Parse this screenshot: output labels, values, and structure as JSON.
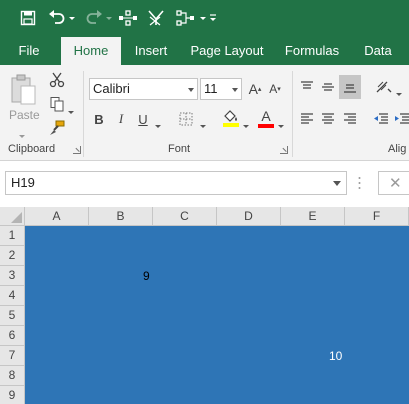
{
  "qat": {
    "icons": [
      "save-icon",
      "undo-icon",
      "redo-icon",
      "group-icon",
      "filter-icon",
      "ungroup-icon",
      "customize-icon"
    ]
  },
  "tabs": [
    {
      "label": "File",
      "active": false
    },
    {
      "label": "Home",
      "active": true
    },
    {
      "label": "Insert",
      "active": false
    },
    {
      "label": "Page Layout",
      "active": false
    },
    {
      "label": "Formulas",
      "active": false
    },
    {
      "label": "Data",
      "active": false
    }
  ],
  "ribbon": {
    "clipboard": {
      "label": "Clipboard",
      "paste_label": "Paste"
    },
    "font": {
      "label": "Font",
      "font_name": "Calibri",
      "font_size": "11",
      "bold": "B",
      "italic": "I",
      "underline": "U",
      "font_color_glyph": "A"
    },
    "alignment": {
      "label": "Alig"
    }
  },
  "formula_bar": {
    "name_box": "H19",
    "cancel_glyph": "✕"
  },
  "grid": {
    "columns": [
      "A",
      "B",
      "C",
      "D",
      "E",
      "F"
    ],
    "rows": [
      "1",
      "2",
      "3",
      "4",
      "5",
      "6",
      "7",
      "8",
      "9"
    ],
    "fill_color": "#2e75b6",
    "cells": [
      {
        "ref": "B3",
        "value": "9",
        "color": "#000000"
      },
      {
        "ref": "E7",
        "value": "10",
        "color": "#ffffff"
      }
    ]
  },
  "colors": {
    "accent": "#217346",
    "ribbon_bg": "#f3f3f3",
    "header_bg": "#e6e6e6"
  }
}
